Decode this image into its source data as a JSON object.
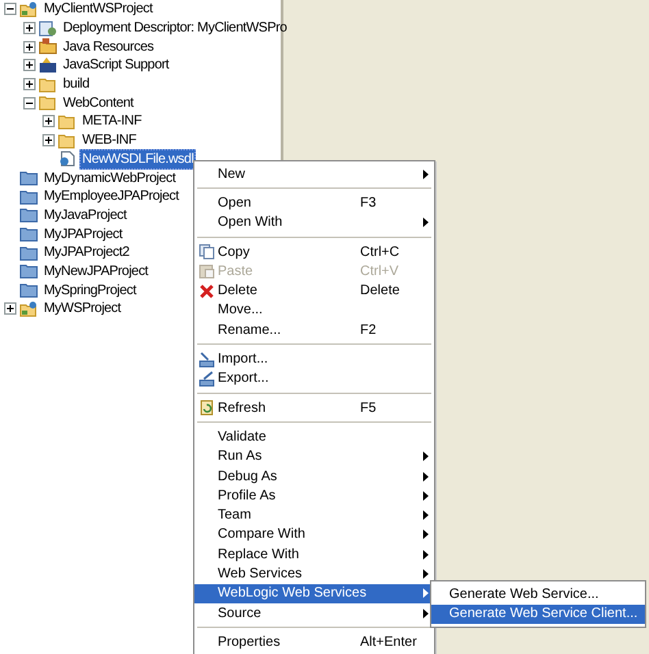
{
  "tree": [
    {
      "label": "MyClientWSProject",
      "kind": "project",
      "expanded": true,
      "selected": false,
      "children": [
        {
          "label": "Deployment Descriptor: MyClientWSPro",
          "kind": "descriptor",
          "expanded": false,
          "selected": false
        },
        {
          "label": "Java Resources",
          "kind": "resources",
          "expanded": false,
          "selected": false
        },
        {
          "label": "JavaScript Support",
          "kind": "script",
          "expanded": false,
          "selected": false
        },
        {
          "label": "build",
          "kind": "folder",
          "expanded": false,
          "selected": false
        },
        {
          "label": "WebContent",
          "kind": "folder",
          "expanded": true,
          "selected": false,
          "children": [
            {
              "label": "META-INF",
              "kind": "folder",
              "expanded": false,
              "selected": false
            },
            {
              "label": "WEB-INF",
              "kind": "folder",
              "expanded": false,
              "selected": false
            },
            {
              "label": "NewWSDLFile.wsdl",
              "kind": "file",
              "selected": true
            }
          ]
        }
      ]
    },
    {
      "label": "MyDynamicWebProject",
      "kind": "closed-project",
      "selected": false
    },
    {
      "label": "MyEmployeeJPAProject",
      "kind": "closed-project",
      "selected": false
    },
    {
      "label": "MyJavaProject",
      "kind": "closed-project",
      "selected": false
    },
    {
      "label": "MyJPAProject",
      "kind": "closed-project",
      "selected": false
    },
    {
      "label": "MyJPAProject2",
      "kind": "closed-project",
      "selected": false
    },
    {
      "label": "MyNewJPAProject",
      "kind": "closed-project",
      "selected": false
    },
    {
      "label": "MySpringProject",
      "kind": "closed-project",
      "selected": false
    },
    {
      "label": "MyWSProject",
      "kind": "project",
      "expanded": false,
      "selected": false
    }
  ],
  "context_menu": [
    {
      "kind": "item",
      "label": "New",
      "submenu": true,
      "disabled": false,
      "selected": false
    },
    {
      "kind": "separator"
    },
    {
      "kind": "item",
      "label": "Open",
      "shortcut": "F3",
      "disabled": false,
      "selected": false
    },
    {
      "kind": "item",
      "label": "Open With",
      "submenu": true,
      "disabled": false,
      "selected": false
    },
    {
      "kind": "separator"
    },
    {
      "kind": "item",
      "label": "Copy",
      "shortcut": "Ctrl+C",
      "disabled": false,
      "selected": false
    },
    {
      "kind": "item",
      "label": "Paste",
      "shortcut": "Ctrl+V",
      "disabled": true,
      "selected": false
    },
    {
      "kind": "item",
      "label": "Delete",
      "shortcut": "Delete",
      "disabled": false,
      "selected": false
    },
    {
      "kind": "item",
      "label": "Move...",
      "disabled": false,
      "selected": false
    },
    {
      "kind": "item",
      "label": "Rename...",
      "shortcut": "F2",
      "disabled": false,
      "selected": false
    },
    {
      "kind": "separator"
    },
    {
      "kind": "item",
      "label": "Import...",
      "disabled": false,
      "selected": false
    },
    {
      "kind": "item",
      "label": "Export...",
      "disabled": false,
      "selected": false
    },
    {
      "kind": "separator"
    },
    {
      "kind": "item",
      "label": "Refresh",
      "shortcut": "F5",
      "disabled": false,
      "selected": false
    },
    {
      "kind": "separator"
    },
    {
      "kind": "item",
      "label": "Validate",
      "disabled": false,
      "selected": false
    },
    {
      "kind": "item",
      "label": "Run As",
      "submenu": true,
      "disabled": false,
      "selected": false
    },
    {
      "kind": "item",
      "label": "Debug As",
      "submenu": true,
      "disabled": false,
      "selected": false
    },
    {
      "kind": "item",
      "label": "Profile As",
      "submenu": true,
      "disabled": false,
      "selected": false
    },
    {
      "kind": "item",
      "label": "Team",
      "submenu": true,
      "disabled": false,
      "selected": false
    },
    {
      "kind": "item",
      "label": "Compare With",
      "submenu": true,
      "disabled": false,
      "selected": false
    },
    {
      "kind": "item",
      "label": "Replace With",
      "submenu": true,
      "disabled": false,
      "selected": false
    },
    {
      "kind": "item",
      "label": "Web Services",
      "submenu": true,
      "disabled": false,
      "selected": false
    },
    {
      "kind": "item",
      "label": "WebLogic Web Services",
      "submenu": true,
      "disabled": false,
      "selected": true
    },
    {
      "kind": "item",
      "label": "Source",
      "submenu": true,
      "disabled": false,
      "selected": false
    },
    {
      "kind": "separator"
    },
    {
      "kind": "item",
      "label": "Properties",
      "shortcut": "Alt+Enter",
      "disabled": false,
      "selected": false
    }
  ],
  "submenu": [
    {
      "label": "Generate Web Service...",
      "selected": false
    },
    {
      "label": "Generate Web Service Client...",
      "selected": true
    }
  ]
}
